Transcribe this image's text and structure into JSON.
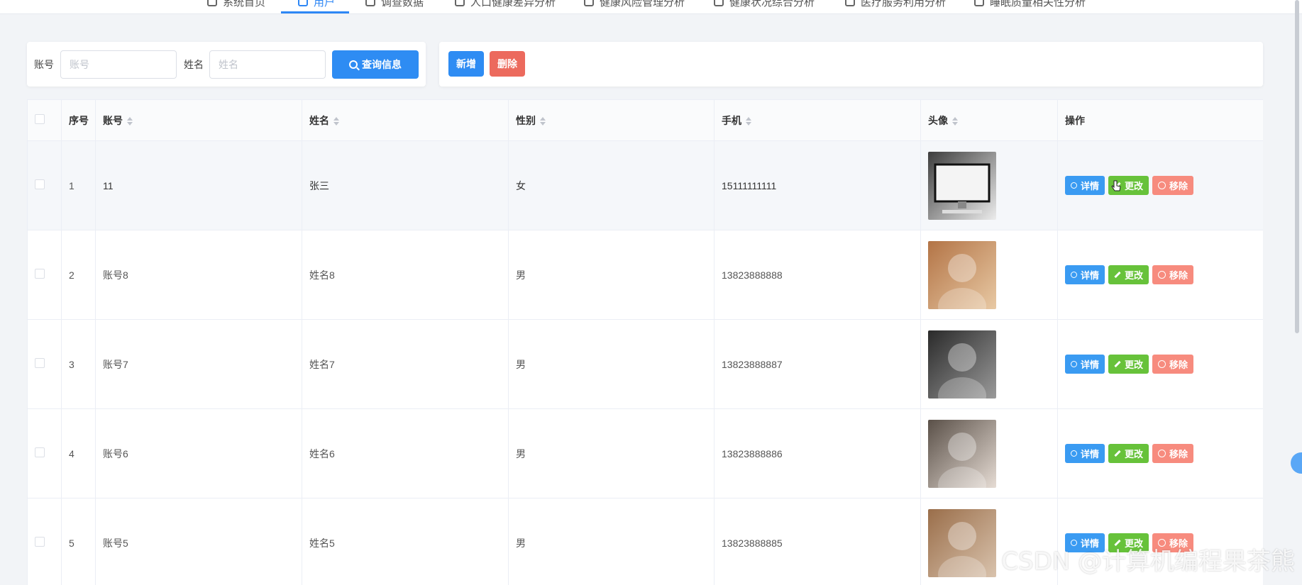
{
  "nav": {
    "items": [
      {
        "label": "系统首页"
      },
      {
        "label": "用户",
        "active": true
      },
      {
        "label": "调查数据"
      },
      {
        "label": "人口健康差异分析"
      },
      {
        "label": "健康风险管理分析"
      },
      {
        "label": "健康状况综合分析"
      },
      {
        "label": "医疗服务利用分析"
      },
      {
        "label": "睡眠质量相关性分析"
      }
    ]
  },
  "search": {
    "account_label": "账号",
    "account_placeholder": "账号",
    "name_label": "姓名",
    "name_placeholder": "姓名",
    "search_button": "查询信息"
  },
  "actions": {
    "add_label": "新增",
    "delete_label": "删除"
  },
  "table": {
    "headers": {
      "index": "序号",
      "account": "账号",
      "name": "姓名",
      "gender": "性别",
      "phone": "手机",
      "avatar": "头像",
      "ops": "操作"
    },
    "ops": {
      "detail": "详情",
      "edit": "更改",
      "remove": "移除"
    },
    "rows": [
      {
        "index": "1",
        "account": "11",
        "name": "张三",
        "gender": "女",
        "phone": "15111111111",
        "avatar": "monitor-study-image",
        "avatar_colors": [
          "#3d3d3d",
          "#ececec"
        ]
      },
      {
        "index": "2",
        "account": "账号8",
        "name": "姓名8",
        "gender": "男",
        "phone": "13823888888",
        "avatar": "cat-image",
        "avatar_colors": [
          "#b37446",
          "#e8c9a4"
        ]
      },
      {
        "index": "3",
        "account": "账号7",
        "name": "姓名7",
        "gender": "男",
        "phone": "13823888887",
        "avatar": "man-bw-image",
        "avatar_colors": [
          "#2a2a2a",
          "#9a9a9a"
        ]
      },
      {
        "index": "4",
        "account": "账号6",
        "name": "姓名6",
        "gender": "男",
        "phone": "13823888886",
        "avatar": "man-portrait-image",
        "avatar_colors": [
          "#5a5048",
          "#e6dcd4"
        ]
      },
      {
        "index": "5",
        "account": "账号5",
        "name": "姓名5",
        "gender": "男",
        "phone": "13823888885",
        "avatar": "woman-street-image",
        "avatar_colors": [
          "#9a6e4a",
          "#d9c3ad"
        ]
      }
    ]
  },
  "watermark": "CSDN @计算机编程果茶熊"
}
